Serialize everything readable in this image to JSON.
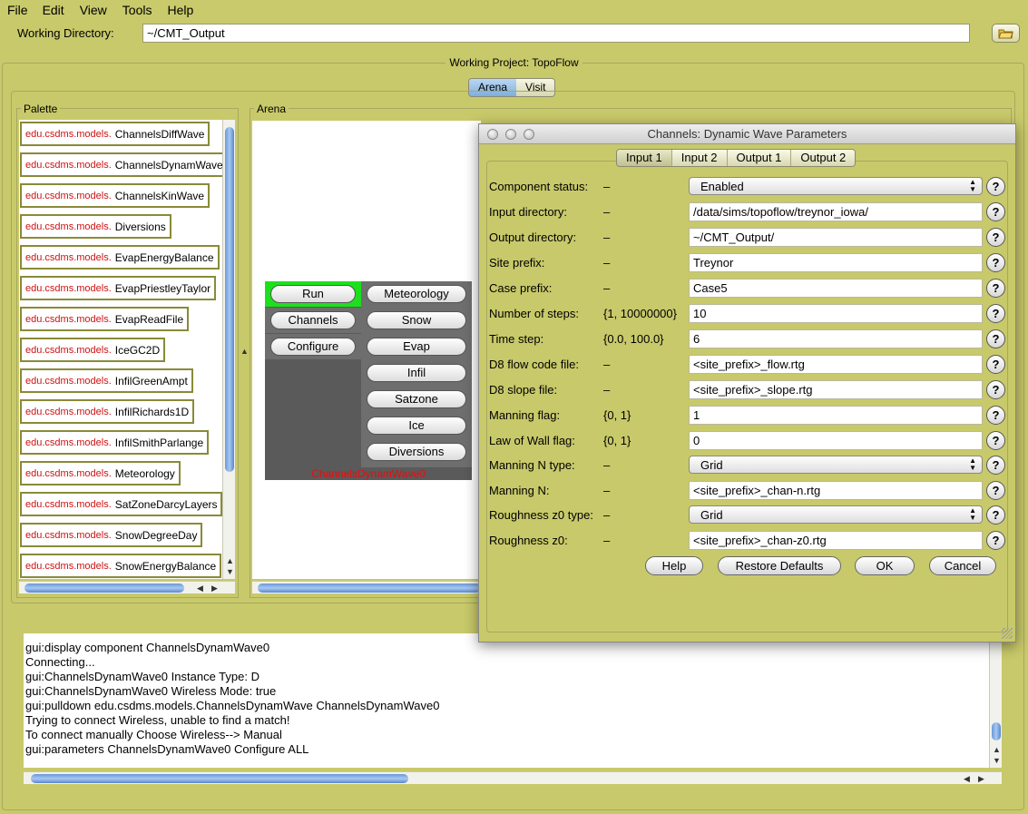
{
  "menu": [
    "File",
    "Edit",
    "View",
    "Tools",
    "Help"
  ],
  "working_directory": {
    "label": "Working Directory:",
    "value": "~/CMT_Output"
  },
  "project": {
    "title": "Working Project: TopoFlow",
    "tabs": [
      "Arena",
      "Visit"
    ],
    "active_tab": "Arena"
  },
  "palette": {
    "title": "Palette",
    "prefix": "edu.csdms.models.",
    "items": [
      "ChannelsDiffWave",
      "ChannelsDynamWave",
      "ChannelsKinWave",
      "Diversions",
      "EvapEnergyBalance",
      "EvapPriestleyTaylor",
      "EvapReadFile",
      "IceGC2D",
      "InfilGreenAmpt",
      "InfilRichards1D",
      "InfilSmithParlange",
      "Meteorology",
      "SatZoneDarcyLayers",
      "SnowDegreeDay",
      "SnowEnergyBalance"
    ]
  },
  "arena": {
    "title": "Arena",
    "widget": {
      "left_buttons": [
        "Run",
        "Channels",
        "Configure"
      ],
      "right_buttons": [
        "Meteorology",
        "Snow",
        "Evap",
        "Infil",
        "Satzone",
        "Ice",
        "Diversions"
      ],
      "caption": "ChannelsDynamWave0"
    }
  },
  "console": {
    "lines": [
      "gui:display component ChannelsDynamWave0",
      "Connecting...",
      "gui:ChannelsDynamWave0 Instance Type: D",
      "gui:ChannelsDynamWave0 Wireless Mode: true",
      "gui:pulldown edu.csdms.models.ChannelsDynamWave ChannelsDynamWave0",
      "Trying to connect Wireless, unable to find a match!",
      "To connect manually Choose Wireless--> Manual",
      "gui:parameters ChannelsDynamWave0 Configure ALL"
    ]
  },
  "dialog": {
    "title": "Channels: Dynamic Wave Parameters",
    "tabs": [
      "Input 1",
      "Input 2",
      "Output 1",
      "Output 2"
    ],
    "active_tab": "Input 1",
    "help_glyph": "?",
    "params": [
      {
        "label": "Component status:",
        "range": "–",
        "value": "Enabled",
        "kind": "select"
      },
      {
        "label": "Input directory:",
        "range": "–",
        "value": "/data/sims/topoflow/treynor_iowa/",
        "kind": "text"
      },
      {
        "label": "Output directory:",
        "range": "–",
        "value": "~/CMT_Output/",
        "kind": "text"
      },
      {
        "label": "Site prefix:",
        "range": "–",
        "value": "Treynor",
        "kind": "text"
      },
      {
        "label": "Case prefix:",
        "range": "–",
        "value": "Case5",
        "kind": "text"
      },
      {
        "label": "Number of steps:",
        "range": "{1, 10000000}",
        "value": "10",
        "kind": "text"
      },
      {
        "label": "Time step:",
        "range": "{0.0, 100.0}",
        "value": "6",
        "kind": "text"
      },
      {
        "label": "D8 flow code file:",
        "range": "–",
        "value": "<site_prefix>_flow.rtg",
        "kind": "text"
      },
      {
        "label": "D8 slope file:",
        "range": "–",
        "value": "<site_prefix>_slope.rtg",
        "kind": "text"
      },
      {
        "label": "Manning flag:",
        "range": "{0, 1}",
        "value": "1",
        "kind": "text"
      },
      {
        "label": "Law of Wall flag:",
        "range": "{0, 1}",
        "value": "0",
        "kind": "text"
      },
      {
        "label": "Manning N type:",
        "range": "–",
        "value": "Grid",
        "kind": "select"
      },
      {
        "label": "Manning N:",
        "range": "–",
        "value": "<site_prefix>_chan-n.rtg",
        "kind": "text"
      },
      {
        "label": "Roughness z0 type:",
        "range": "–",
        "value": "Grid",
        "kind": "select"
      },
      {
        "label": "Roughness z0:",
        "range": "–",
        "value": "<site_prefix>_chan-z0.rtg",
        "kind": "text"
      }
    ],
    "buttons": [
      "Help",
      "Restore Defaults",
      "OK",
      "Cancel"
    ]
  },
  "colors": {
    "background": "#c8c96a",
    "palette_prefix": "#d01010",
    "run_highlight": "#1de01d",
    "caption": "#e01010"
  }
}
